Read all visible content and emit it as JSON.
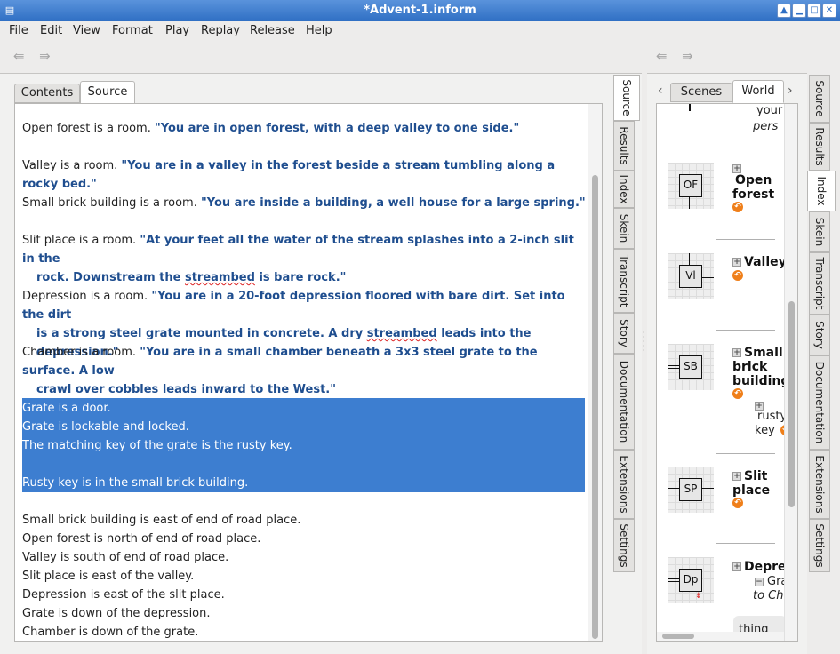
{
  "window": {
    "title": "*Advent-1.inform",
    "app_icon": "book-icon"
  },
  "menubar": [
    "File",
    "Edit",
    "View",
    "Format",
    "Play",
    "Replay",
    "Release",
    "Help"
  ],
  "left_panel": {
    "tabs": [
      "Contents",
      "Source"
    ],
    "active_tab": "Source",
    "side_tabs": [
      "Source",
      "Results",
      "Index",
      "Skein",
      "Transcript",
      "Story",
      "Documentation",
      "Extensions",
      "Settings"
    ],
    "source": {
      "paragraphs": [
        {
          "plain": "Open forest is a room. ",
          "quote": "\"You are in open forest, with a deep valley to one side.\""
        },
        {
          "plain": "Valley is a room. ",
          "quote": "\"You are in a valley in the forest beside a stream tumbling along a rocky bed.\""
        },
        {
          "plain": "Small brick building is a room. ",
          "quote": "\"You are inside a building, a well house for a large spring.\""
        },
        {
          "plain": "Slit place is a room. ",
          "quote_line1": "\"At your feet all the water of the stream splashes into a 2-inch slit in the",
          "quote_line2a": "rock. Downstream the ",
          "quote_line2_sq": "streambed",
          "quote_line2b": " is bare rock.\""
        },
        {
          "plain": "Depression is a room. ",
          "quote_line1": "\"You are in a 20-foot depression floored with bare dirt. Set into the dirt",
          "quote_line2a": "is a strong steel grate mounted in concrete. A dry ",
          "quote_line2_sq": "streambed",
          "quote_line2b": " leads into the depression.\""
        },
        {
          "plain": "Chamber is a room. ",
          "quote_line1": "\"You are in a small chamber beneath a 3x3 steel grate to the surface. A low",
          "quote_line2": "crawl over cobbles leads inward to the West.\""
        }
      ],
      "selected_lines": [
        "Grate is a door.",
        "Grate is lockable and locked.",
        "The matching key of the grate is the rusty key.",
        "",
        "Rusty key is in the small brick building."
      ],
      "trailing_lines": [
        "Small brick building is east of end of road place.",
        "Open forest is north of end of road place.",
        "Valley is south of end of road place.",
        "Slit place is east of the valley.",
        "Depression is east of the slit place.",
        "Grate is down of the depression.",
        "Chamber is down of the grate."
      ]
    }
  },
  "right_panel": {
    "tabs": [
      "Scenes",
      "World"
    ],
    "active_tab": "World",
    "side_tabs": [
      "Source",
      "Results",
      "Index",
      "Skein",
      "Transcript",
      "Story",
      "Documentation",
      "Extensions",
      "Settings"
    ],
    "active_side_tab": "Index",
    "world": {
      "top_fragment": [
        "your",
        "pers"
      ],
      "rooms": [
        {
          "abbr": "OF",
          "name_lines": [
            "Open",
            "forest"
          ]
        },
        {
          "abbr": "Vl",
          "name_lines": [
            "Valley"
          ]
        },
        {
          "abbr": "SB",
          "name_lines": [
            "Small",
            "brick",
            "building"
          ],
          "children": [
            "rusty",
            "key"
          ]
        },
        {
          "abbr": "SP",
          "name_lines": [
            "Slit",
            "place"
          ]
        },
        {
          "abbr": "Dp",
          "name_lines": [
            "Depre"
          ],
          "children": [
            "Gra",
            "to Ch"
          ]
        }
      ],
      "bottom_fragment": "thing"
    }
  },
  "colors": {
    "titlebar": "#3d7ed0",
    "selection": "#3d7ed0",
    "quote_text": "#1f4e8f",
    "orange_badge": "#ef7f1a"
  }
}
